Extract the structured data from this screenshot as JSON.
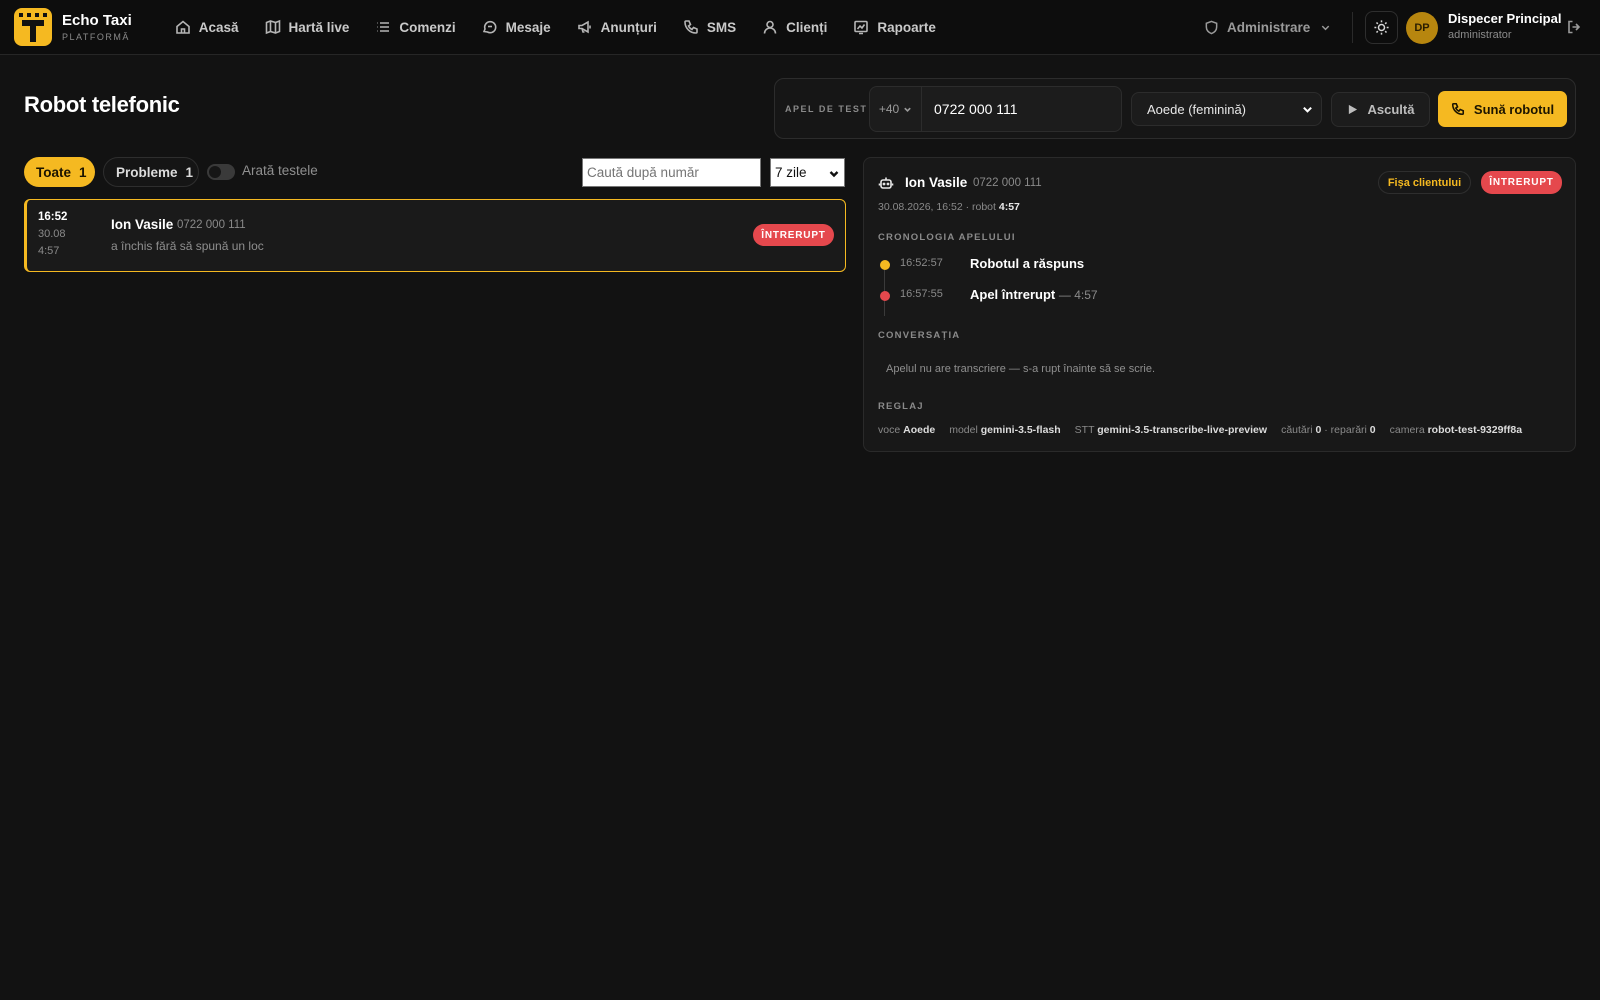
{
  "brand": {
    "name": "Echo Taxi",
    "sub": "PLATFORMĂ"
  },
  "nav": [
    {
      "label": "Acasă",
      "icon": "home-icon"
    },
    {
      "label": "Hartă live",
      "icon": "map-icon"
    },
    {
      "label": "Comenzi",
      "icon": "list-icon"
    },
    {
      "label": "Mesaje",
      "icon": "chat-icon"
    },
    {
      "label": "Anunțuri",
      "icon": "megaphone-icon"
    },
    {
      "label": "SMS",
      "icon": "phone-icon"
    },
    {
      "label": "Clienți",
      "icon": "user-icon"
    },
    {
      "label": "Rapoarte",
      "icon": "chart-icon"
    }
  ],
  "header": {
    "admin_label": "Administrare",
    "avatar_initials": "DP",
    "user_name": "Dispecer Principal",
    "user_role": "administrator"
  },
  "page": {
    "title": "Robot telefonic"
  },
  "test_call": {
    "label": "APEL DE TEST",
    "prefix": "+40",
    "number": "0722 000 111",
    "voice": "Aoede (feminină)",
    "listen_label": "Ascultă",
    "call_label": "Sună robotul"
  },
  "filters": {
    "all_label": "Toate",
    "all_count": "1",
    "problems_label": "Probleme",
    "problems_count": "1",
    "show_tests_label": "Arată testele",
    "show_tests_on": false,
    "search_placeholder": "Caută după număr",
    "period": "7 zile"
  },
  "calls": [
    {
      "time": "16:52",
      "date": "30.08",
      "duration": "4:57",
      "name": "Ion Vasile",
      "phone": "0722 000 111",
      "summary": "a închis fără să spună un loc",
      "status": "ÎNTRERUPT"
    }
  ],
  "detail": {
    "name": "Ion Vasile",
    "phone": "0722 000 111",
    "meta_prefix": "30.08.2026, 16:52 · robot",
    "meta_duration": "4:57",
    "client_sheet_label": "Fișa clientului",
    "status": "ÎNTRERUPT",
    "timeline_title": "CRONOLOGIA APELULUI",
    "timeline": [
      {
        "time": "16:52:57",
        "text": "Robotul a răspuns",
        "extra": "",
        "color": "#f5b921"
      },
      {
        "time": "16:57:55",
        "text": "Apel întrerupt",
        "extra": "— 4:57",
        "color": "#e5484d"
      }
    ],
    "conversation_title": "CONVERSAȚIA",
    "conversation_note": "Apelul nu are transcriere — s-a rupt înainte să se scrie.",
    "settings_title": "REGLAJ",
    "settings": {
      "voice_label": "voce",
      "voice": "Aoede",
      "model_label": "model",
      "model": "gemini-3.5-flash",
      "stt_label": "STT",
      "stt": "gemini-3.5-transcribe-live-preview",
      "searches_label": "căutări",
      "searches": "0",
      "repairs_label": "· reparări",
      "repairs": "0",
      "room_label": "camera",
      "room": "robot-test-9329ff8a"
    }
  },
  "colors": {
    "accent": "#f5b921",
    "danger": "#e5484d",
    "background": "#121212"
  }
}
